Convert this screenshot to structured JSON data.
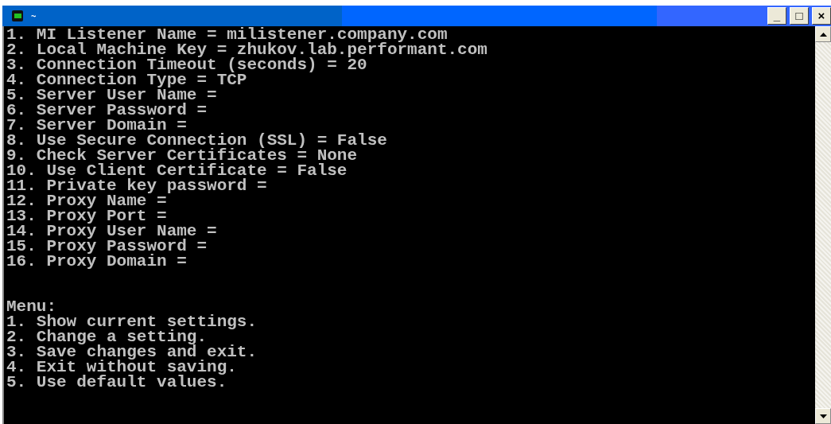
{
  "window": {
    "title": "~",
    "buttons": [
      "_",
      "□",
      "×"
    ]
  },
  "settings": [
    "1. MI Listener Name = milistener.company.com",
    "2. Local Machine Key = zhukov.lab.performant.com",
    "3. Connection Timeout (seconds) = 20",
    "4. Connection Type = TCP",
    "5. Server User Name =",
    "6. Server Password =",
    "7. Server Domain =",
    "8. Use Secure Connection (SSL) = False",
    "9. Check Server Certificates = None",
    "10. Use Client Certificate = False",
    "11. Private key password =",
    "12. Proxy Name =",
    "13. Proxy Port =",
    "14. Proxy User Name =",
    "15. Proxy Password =",
    "16. Proxy Domain ="
  ],
  "menu": {
    "title": "Menu:",
    "items": [
      "1. Show current settings.",
      "2. Change a setting.",
      "3. Save changes and exit.",
      "4. Exit without saving.",
      "5. Use default values."
    ]
  }
}
